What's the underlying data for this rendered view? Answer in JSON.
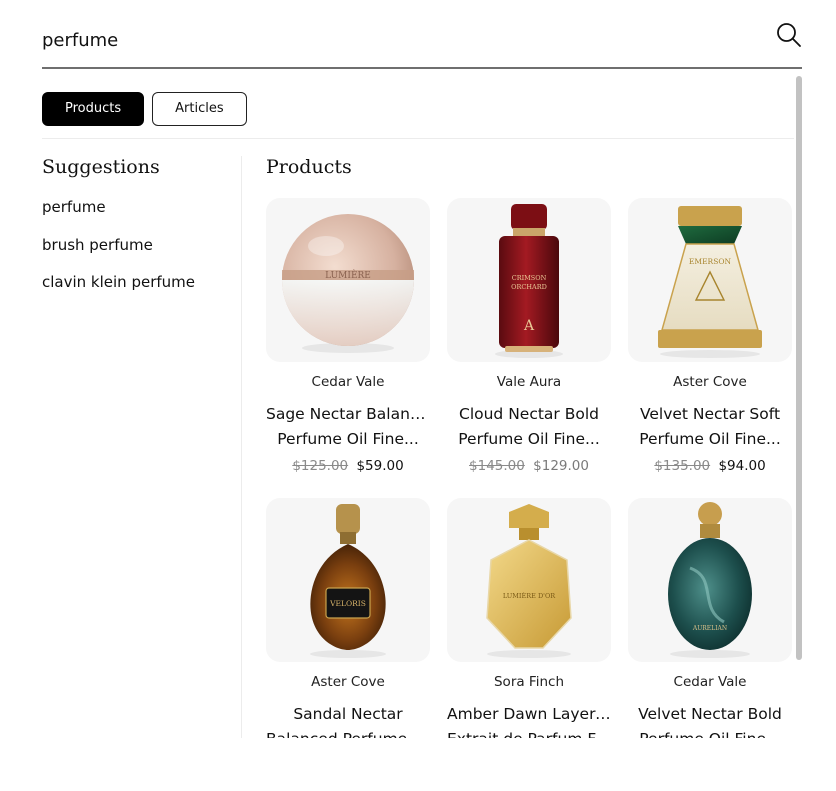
{
  "search": {
    "value": "perfume",
    "icon": "search-icon"
  },
  "tabs": [
    {
      "label": "Products",
      "active": true
    },
    {
      "label": "Articles",
      "active": false
    }
  ],
  "suggestions": {
    "title": "Suggestions",
    "items": [
      "perfume",
      "brush perfume",
      "clavin klein perfume"
    ]
  },
  "products": {
    "title": "Products",
    "items": [
      {
        "brand": "Cedar Vale",
        "name_line1": "Sage Nectar Balanced",
        "name_line2": "Perfume Oil Fine...",
        "old_price": "$125.00",
        "price": "$59.00",
        "price_muted": false,
        "image": "rose-gold-orb-bottle",
        "bottle_label": "LUMIÈRE"
      },
      {
        "brand": "Vale Aura",
        "name_line1": "Cloud Nectar Bold",
        "name_line2": "Perfume Oil Fine...",
        "old_price": "$145.00",
        "price": "$129.00",
        "price_muted": true,
        "image": "crimson-bottle",
        "bottle_label": "CRIMSON ORCHARD"
      },
      {
        "brand": "Aster Cove",
        "name_line1": "Velvet Nectar Soft",
        "name_line2": "Perfume Oil Fine...",
        "old_price": "$135.00",
        "price": "$94.00",
        "price_muted": false,
        "image": "emerald-pyramid-bottle",
        "bottle_label": "EMERSON"
      },
      {
        "brand": "Aster Cove",
        "name_line1": "Sandal Nectar",
        "name_line2": "Balanced Perfume Oi...",
        "old_price": "",
        "price": "",
        "price_muted": false,
        "image": "amber-teardrop-bottle",
        "bottle_label": "VELORIS"
      },
      {
        "brand": "Sora Finch",
        "name_line1": "Amber Dawn Layered",
        "name_line2": "Extrait de Parfum Fin...",
        "old_price": "",
        "price": "",
        "price_muted": false,
        "image": "gold-faceted-bottle",
        "bottle_label": "LUMIÈRE D'OR"
      },
      {
        "brand": "Cedar Vale",
        "name_line1": "Velvet Nectar Bold",
        "name_line2": "Perfume Oil Fine...",
        "old_price": "",
        "price": "",
        "price_muted": false,
        "image": "teal-swirl-bottle",
        "bottle_label": "AURELIAN"
      }
    ]
  },
  "colors": {
    "accent": "#000000",
    "muted_price": "#7a7a7a",
    "strike_price": "#8a8a8a"
  }
}
